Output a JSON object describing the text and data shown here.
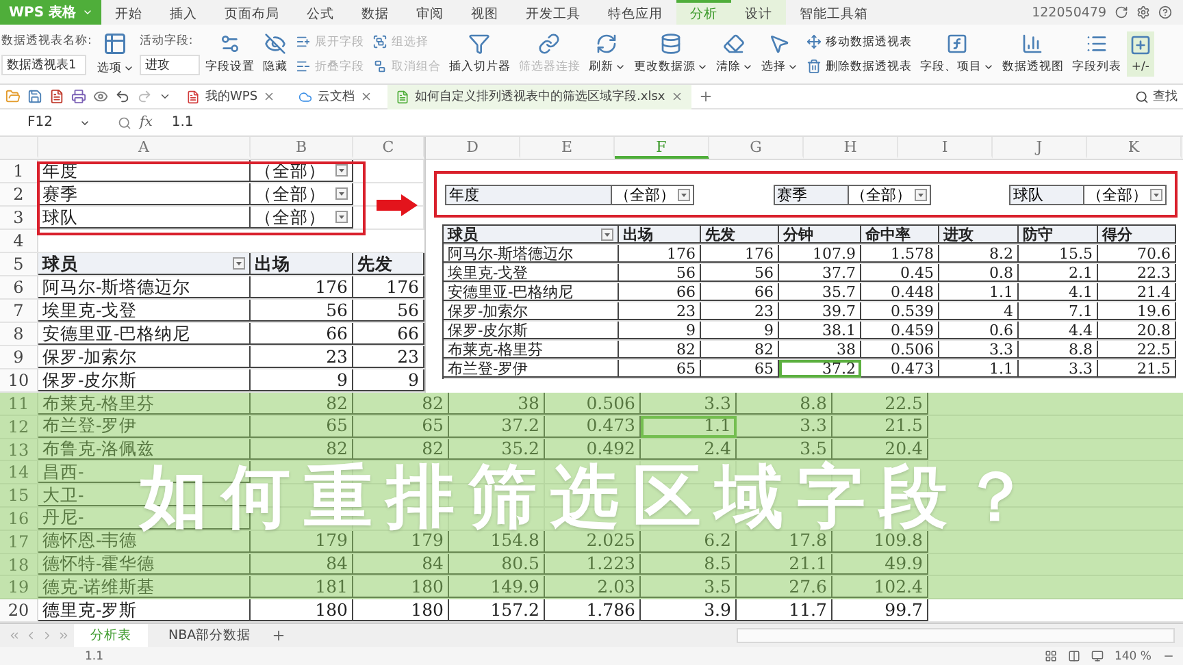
{
  "app_logo": "WPS 表格",
  "menu_tabs": [
    {
      "label": "开始",
      "selected": false,
      "contextual": false
    },
    {
      "label": "插入",
      "selected": false,
      "contextual": false
    },
    {
      "label": "页面布局",
      "selected": false,
      "contextual": false
    },
    {
      "label": "公式",
      "selected": false,
      "contextual": false
    },
    {
      "label": "数据",
      "selected": false,
      "contextual": false
    },
    {
      "label": "审阅",
      "selected": false,
      "contextual": false
    },
    {
      "label": "视图",
      "selected": false,
      "contextual": false
    },
    {
      "label": "开发工具",
      "selected": false,
      "contextual": false
    },
    {
      "label": "特色应用",
      "selected": false,
      "contextual": false
    },
    {
      "label": "分析",
      "selected": true,
      "contextual": true
    },
    {
      "label": "设计",
      "selected": false,
      "contextual": true
    },
    {
      "label": "智能工具箱",
      "selected": false,
      "contextual": false
    }
  ],
  "account": {
    "user_id": "122050479"
  },
  "ribbon": {
    "pivot_name_label": "数据透视表名称:",
    "pivot_name": "数据透视表1",
    "options_button": {
      "label": "选项",
      "dropdown": true
    },
    "active_field_label": "活动字段:",
    "active_field": "进攻",
    "groups": [
      {
        "kind": "large",
        "items": [
          {
            "label": "字段设置",
            "disabled": false,
            "dropdown": false
          },
          {
            "label": "隐藏",
            "disabled": false,
            "dropdown": false
          }
        ]
      },
      {
        "kind": "stack",
        "items": [
          {
            "label": "展开字段",
            "disabled": true,
            "dropdown": false
          },
          {
            "label": "折叠字段",
            "disabled": true,
            "dropdown": false
          }
        ]
      },
      {
        "kind": "stack",
        "items": [
          {
            "label": "组选择",
            "disabled": true,
            "dropdown": false
          },
          {
            "label": "取消组合",
            "disabled": true,
            "dropdown": false
          }
        ]
      },
      {
        "kind": "large",
        "items": [
          {
            "label": "插入切片器",
            "disabled": false,
            "dropdown": false
          },
          {
            "label": "筛选器连接",
            "disabled": true,
            "dropdown": false
          }
        ]
      },
      {
        "kind": "large",
        "items": [
          {
            "label": "刷新",
            "disabled": false,
            "dropdown": true
          },
          {
            "label": "更改数据源",
            "disabled": false,
            "dropdown": true
          }
        ]
      },
      {
        "kind": "large",
        "items": [
          {
            "label": "清除",
            "disabled": false,
            "dropdown": true
          },
          {
            "label": "选择",
            "disabled": false,
            "dropdown": true
          }
        ]
      },
      {
        "kind": "stack",
        "items": [
          {
            "label": "移动数据透视表",
            "disabled": false,
            "dropdown": false
          },
          {
            "label": "删除数据透视表",
            "disabled": false,
            "dropdown": false
          }
        ]
      },
      {
        "kind": "large",
        "items": [
          {
            "label": "字段、项目",
            "disabled": false,
            "dropdown": true
          }
        ]
      },
      {
        "kind": "large",
        "items": [
          {
            "label": "数据透视图",
            "disabled": false,
            "dropdown": false
          }
        ]
      },
      {
        "kind": "large",
        "items": [
          {
            "label": "字段列表",
            "disabled": false,
            "dropdown": false
          }
        ]
      },
      {
        "kind": "large",
        "items": [
          {
            "label": "+/-",
            "disabled": false,
            "dropdown": false
          }
        ]
      }
    ]
  },
  "doc_tabs": [
    {
      "label": "我的WPS",
      "selected": false
    },
    {
      "label": "云文档",
      "selected": false
    },
    {
      "label": "如何自定义排列透视表中的筛选区域字段.xlsx",
      "selected": true
    }
  ],
  "search_box": {
    "label": "查找"
  },
  "formula_bar": {
    "cell": "F12",
    "function_label": "fx",
    "value": "1.1"
  },
  "sheet": {
    "column_letters": [
      "A",
      "B",
      "C"
    ],
    "filters": [
      {
        "row": "1",
        "label": "年度",
        "value": "（全部）"
      },
      {
        "row": "2",
        "label": "赛季",
        "value": "（全部）"
      },
      {
        "row": "3",
        "label": "球队",
        "value": "（全部）"
      }
    ],
    "blank_row": "4",
    "header": {
      "row": "5",
      "cells": [
        "球员",
        "出场",
        "先发"
      ]
    },
    "rows": [
      {
        "row": "6",
        "cells": [
          "阿马尔-斯塔德迈尔",
          "176",
          "176"
        ]
      },
      {
        "row": "7",
        "cells": [
          "埃里克-戈登",
          "56",
          "56"
        ]
      },
      {
        "row": "8",
        "cells": [
          "安德里亚-巴格纳尼",
          "66",
          "66"
        ]
      },
      {
        "row": "9",
        "cells": [
          "保罗-加索尔",
          "23",
          "23"
        ]
      },
      {
        "row": "10",
        "cells": [
          "保罗-皮尔斯",
          "9",
          "9"
        ]
      }
    ],
    "lower_rows": [
      {
        "row": "11",
        "cells": [
          "布莱克-格里芬",
          "82",
          "82",
          "38",
          "0.506",
          "3.3",
          "8.8",
          "22.5"
        ]
      },
      {
        "row": "12",
        "cells": [
          "布兰登-罗伊",
          "65",
          "65",
          "37.2",
          "0.473",
          {
            "text": "1.1",
            "active": true
          },
          "3.3",
          "21.5"
        ]
      },
      {
        "row": "13",
        "cells": [
          "布鲁克-洛佩兹",
          "82",
          "82",
          "35.2",
          "0.492",
          "2.4",
          "3.5",
          "20.4"
        ]
      },
      {
        "row": "14",
        "cells": [
          "昌西-"
        ]
      },
      {
        "row": "15",
        "cells": [
          "大卫-"
        ]
      },
      {
        "row": "16",
        "cells": [
          "丹尼-"
        ]
      },
      {
        "row": "17",
        "cells": [
          "德怀恩-韦德",
          "179",
          "179",
          "154.8",
          "2.025",
          "6.2",
          "17.8",
          "109.8"
        ]
      },
      {
        "row": "18",
        "cells": [
          "德怀特-霍华德",
          "84",
          "84",
          "80.5",
          "1.223",
          "8.5",
          "21.1",
          "49.9"
        ]
      },
      {
        "row": "19",
        "cells": [
          "德克-诺维斯基",
          "181",
          "180",
          "149.9",
          "2.03",
          "3.5",
          "27.6",
          "102.4"
        ]
      },
      {
        "row": "20",
        "cells": [
          "德里克-罗斯",
          "180",
          "180",
          "157.2",
          "1.786",
          "3.9",
          "11.7",
          "99.7"
        ]
      }
    ]
  },
  "inset": {
    "column_letters": [
      {
        "label": "D",
        "selected": false
      },
      {
        "label": "E",
        "selected": false
      },
      {
        "label": "F",
        "selected": true
      },
      {
        "label": "G",
        "selected": false
      },
      {
        "label": "H",
        "selected": false
      },
      {
        "label": "I",
        "selected": false
      },
      {
        "label": "J",
        "selected": false
      },
      {
        "label": "K",
        "selected": false
      }
    ],
    "filters": [
      {
        "label": "年度",
        "value": "（全部）"
      },
      {
        "label": "赛季",
        "value": "（全部）"
      },
      {
        "label": "球队",
        "value": "（全部）"
      }
    ],
    "header": [
      "球员",
      "出场",
      "先发",
      "分钟",
      "命中率",
      "进攻",
      "防守",
      "得分"
    ],
    "rows": [
      {
        "cells": [
          "阿马尔-斯塔德迈尔",
          "176",
          "176",
          "107.9",
          "1.578",
          "8.2",
          "15.5",
          "70.6"
        ]
      },
      {
        "cells": [
          "埃里克-戈登",
          "56",
          "56",
          "37.7",
          "0.45",
          "0.8",
          "2.1",
          "22.3"
        ]
      },
      {
        "cells": [
          "安德里亚-巴格纳尼",
          "66",
          "66",
          "35.7",
          "0.448",
          "1.1",
          "4.1",
          "21.4"
        ]
      },
      {
        "cells": [
          "保罗-加索尔",
          "23",
          "23",
          "39.7",
          "0.539",
          "4",
          "7.1",
          "19.6"
        ]
      },
      {
        "cells": [
          "保罗-皮尔斯",
          "9",
          "9",
          "38.1",
          "0.459",
          "0.6",
          "4.4",
          "20.8"
        ]
      },
      {
        "cells": [
          "布莱克-格里芬",
          "82",
          "82",
          "38",
          "0.506",
          "3.3",
          "8.8",
          "22.5"
        ]
      },
      {
        "cells": [
          "布兰登-罗伊",
          "65",
          "65",
          {
            "text": "37.2",
            "active": true
          },
          "0.473",
          "1.1",
          "3.3",
          "21.5"
        ]
      }
    ]
  },
  "banner": {
    "title": "如何重排筛选区域字段？"
  },
  "sheet_tabs": [
    {
      "label": "分析表",
      "selected": true
    },
    {
      "label": "NBA部分数据",
      "selected": false
    }
  ],
  "status_bar": {
    "value": "1.1",
    "zoom": "140 %"
  }
}
